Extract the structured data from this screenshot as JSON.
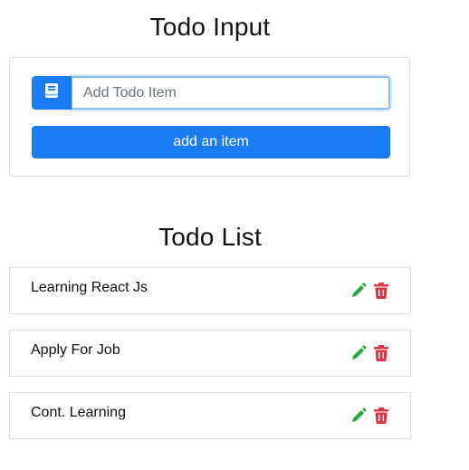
{
  "input_section": {
    "title": "Todo Input",
    "placeholder": "Add Todo Item",
    "value": "",
    "add_button_label": "add an item",
    "prepend_icon": "book-icon"
  },
  "list_section": {
    "title": "Todo List",
    "items": [
      {
        "text": "Learning React Js",
        "edit_icon": "pencil-icon",
        "delete_icon": "trash-icon"
      },
      {
        "text": "Apply For Job",
        "edit_icon": "pencil-icon",
        "delete_icon": "trash-icon"
      },
      {
        "text": "Cont. Learning",
        "edit_icon": "pencil-icon",
        "delete_icon": "trash-icon"
      }
    ]
  },
  "colors": {
    "primary": "#1a7cf2",
    "edit": "#28a745",
    "delete": "#dc3545",
    "border": "#dee2e6"
  }
}
